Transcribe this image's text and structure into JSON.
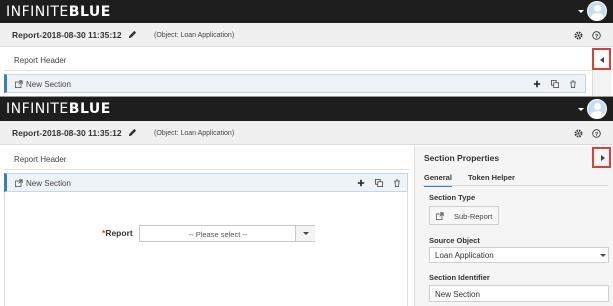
{
  "brand": {
    "part1": "INFINITE",
    "part2": "BLUE"
  },
  "report": {
    "title": "Report-2018-08-30 11:35:12",
    "object": "(Object: Loan Application)"
  },
  "canvas": {
    "report_header": "Report Header",
    "section_label": "New Section"
  },
  "form": {
    "report_label": "Report",
    "required_mark": "*",
    "report_placeholder": "-- Please select --"
  },
  "panel": {
    "title": "Section Properties",
    "tabs": [
      {
        "label": "General",
        "active": true
      },
      {
        "label": "Token Helper",
        "active": false
      }
    ],
    "section_type_label": "Section Type",
    "section_type_value": "Sub-Report",
    "source_object_label": "Source Object",
    "source_object_value": "Loan Application",
    "section_identifier_label": "Section Identifier",
    "section_identifier_value": "New Section"
  },
  "colors": {
    "accent": "#3a7ec1",
    "highlight": "#d9403a",
    "topbar": "#1e1e1e"
  },
  "icons": {
    "pencil": "pencil-icon",
    "gear": "gear-icon",
    "help": "help-icon",
    "external": "external-link-icon",
    "plus": "plus-icon",
    "copy": "copy-icon",
    "trash": "trash-icon",
    "collapse_left": "chevron-left-icon",
    "collapse_right": "chevron-right-icon",
    "user": "user-avatar-icon"
  }
}
